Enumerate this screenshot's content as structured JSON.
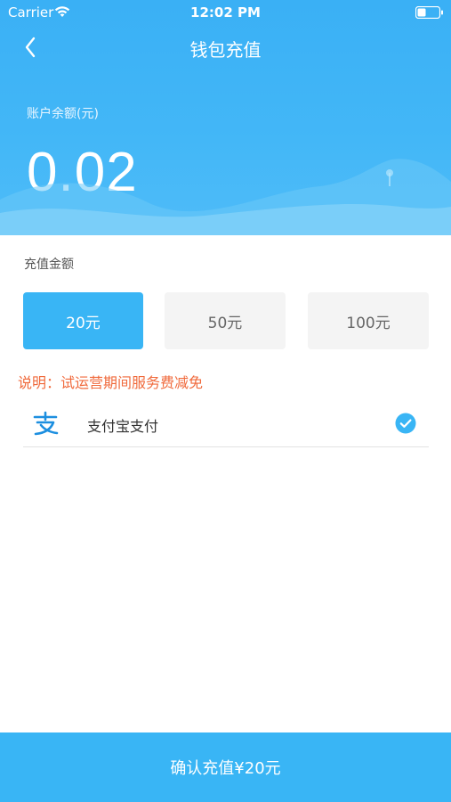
{
  "status_bar": {
    "carrier": "Carrier",
    "time": "12:02 PM"
  },
  "nav": {
    "title": "钱包充值"
  },
  "balance": {
    "label": "账户余额(元)",
    "value": "0.02"
  },
  "recharge": {
    "amount_label": "充值金额",
    "options": [
      {
        "label": "20元",
        "selected": true
      },
      {
        "label": "50元",
        "selected": false
      },
      {
        "label": "100元",
        "selected": false
      }
    ],
    "notice": "说明：试运营期间服务费减免"
  },
  "payment": {
    "method_label": "支付宝支付",
    "selected": true
  },
  "footer": {
    "confirm_label": "确认充值¥20元"
  },
  "colors": {
    "primary": "#39b5f5",
    "notice": "#f06a3c",
    "option_bg": "#f4f4f4"
  },
  "icons": [
    "wifi-icon",
    "battery-icon",
    "back-chevron-icon",
    "alipay-icon",
    "check-circle-icon"
  ]
}
